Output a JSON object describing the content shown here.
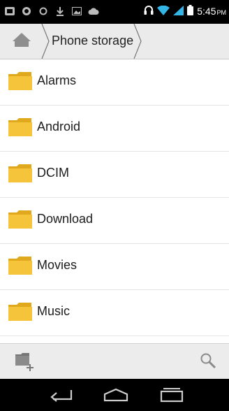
{
  "status_bar": {
    "time": "5:45",
    "ampm": "PM",
    "icons": [
      "notification-icon",
      "sync-icon",
      "circle-icon",
      "download-icon",
      "image-icon",
      "cloud-icon",
      "headset-icon",
      "wifi-icon",
      "signal-icon",
      "battery-icon"
    ]
  },
  "breadcrumb": {
    "home_icon": "home-icon",
    "current": "Phone storage"
  },
  "folders": [
    {
      "label": "Alarms",
      "icon": "folder-icon"
    },
    {
      "label": "Android",
      "icon": "folder-icon"
    },
    {
      "label": "DCIM",
      "icon": "folder-icon"
    },
    {
      "label": "Download",
      "icon": "folder-icon"
    },
    {
      "label": "Movies",
      "icon": "folder-icon"
    },
    {
      "label": "Music",
      "icon": "folder-icon"
    }
  ],
  "bottom_bar": {
    "new_folder_icon": "new-folder-icon",
    "search_icon": "search-icon"
  },
  "nav_bar": {
    "icons": [
      "back-icon",
      "home-icon",
      "recents-icon"
    ]
  },
  "colors": {
    "folder": "#f5c43a",
    "folder_dark": "#e0a81c",
    "breadcrumb_bg": "#ebebeb",
    "bottombar_bg": "#ececec"
  }
}
